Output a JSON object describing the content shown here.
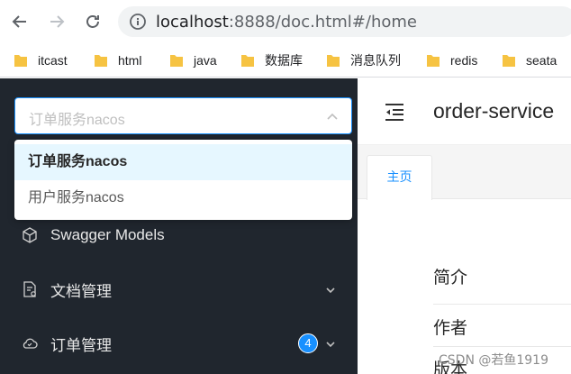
{
  "browser": {
    "url_host": "localhost",
    "url_rest": ":8888/doc.html#/home"
  },
  "bookmarks": [
    "itcast",
    "html",
    "java",
    "数据库",
    "消息队列",
    "redis",
    "seata"
  ],
  "sidebar": {
    "select_placeholder": "订单服务nacos",
    "dropdown_options": [
      "订单服务nacos",
      "用户服务nacos"
    ],
    "selected_option": "订单服务nacos",
    "menu": [
      {
        "label": "Swagger Models"
      },
      {
        "label": "文档管理"
      },
      {
        "label": "订单管理",
        "badge": "4"
      }
    ]
  },
  "main": {
    "service_title": "order-service",
    "tab_label": "主页",
    "info_rows": [
      "简介",
      "作者",
      "版本"
    ]
  },
  "watermark": "CSDN @若鱼1919",
  "colors": {
    "sidebar_bg": "#20262e",
    "accent": "#1890ff",
    "dropdown_active_bg": "#e6f7ff"
  }
}
